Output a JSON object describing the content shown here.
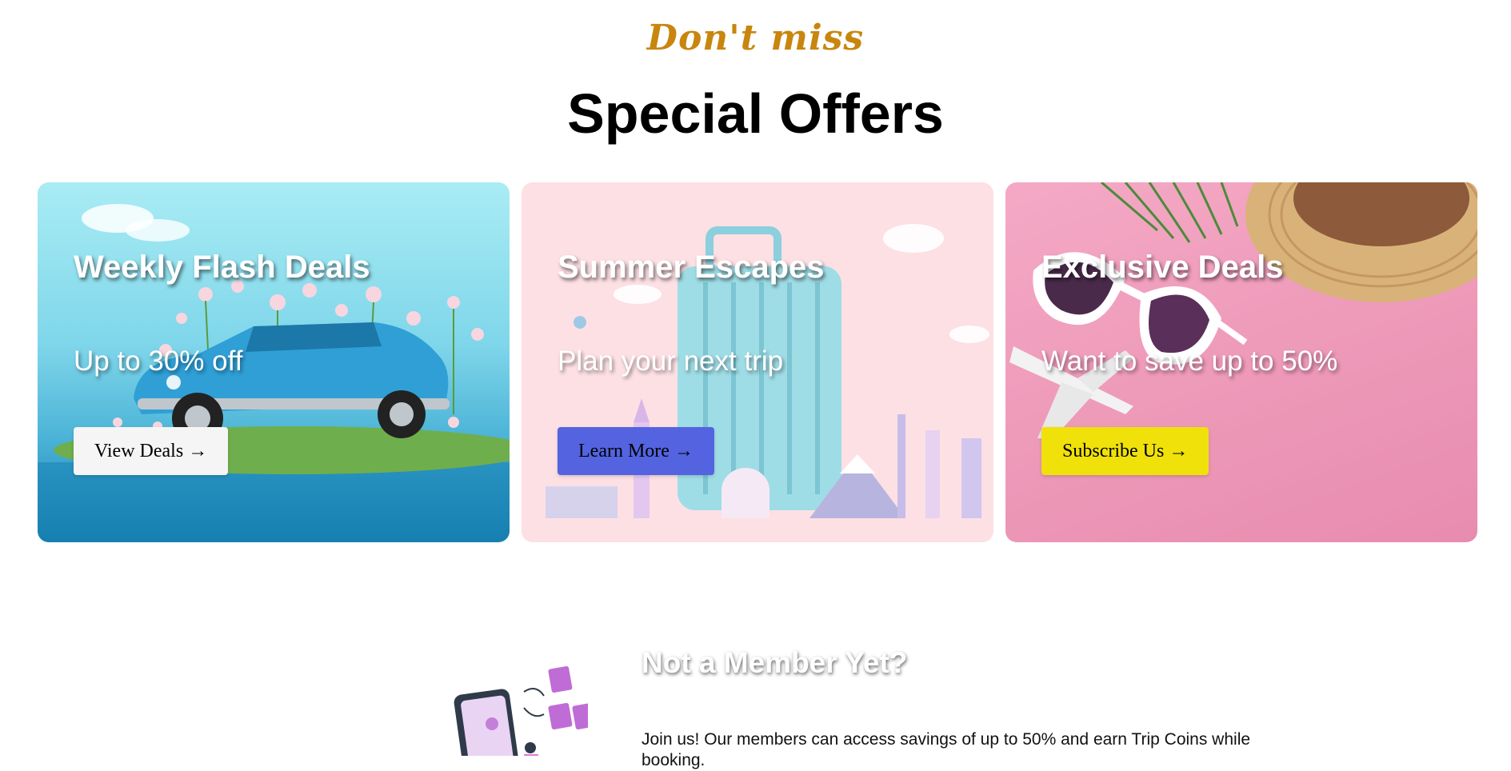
{
  "header": {
    "tagline": "Don't miss",
    "title": "Special Offers"
  },
  "offers": [
    {
      "title": "Weekly Flash Deals",
      "subtitle": "Up to 30% off",
      "button": "View Deals →",
      "image": "blue-convertible-car-with-flowers",
      "button_color": "#f5f5f5"
    },
    {
      "title": "Summer Escapes",
      "subtitle": "Plan your next trip",
      "button": "Learn More →",
      "image": "suitcase-with-world-landmarks",
      "button_color": "#5464e0"
    },
    {
      "title": "Exclusive Deals",
      "subtitle": "Want to save up to 50%",
      "button": "Subscribe Us →",
      "image": "sunglasses-hat-toy-airplane",
      "button_color": "#f0e10a"
    }
  ],
  "member": {
    "title": "Not a Member Yet?",
    "text": "Join us! Our members can access savings of up to 50% and earn Trip Coins while booking.",
    "illustration": "phone-security-illustration"
  },
  "colors": {
    "accent": "#c8860e",
    "card2_bg": "#fde0e4",
    "card3_bg": "#ee9ab9"
  }
}
